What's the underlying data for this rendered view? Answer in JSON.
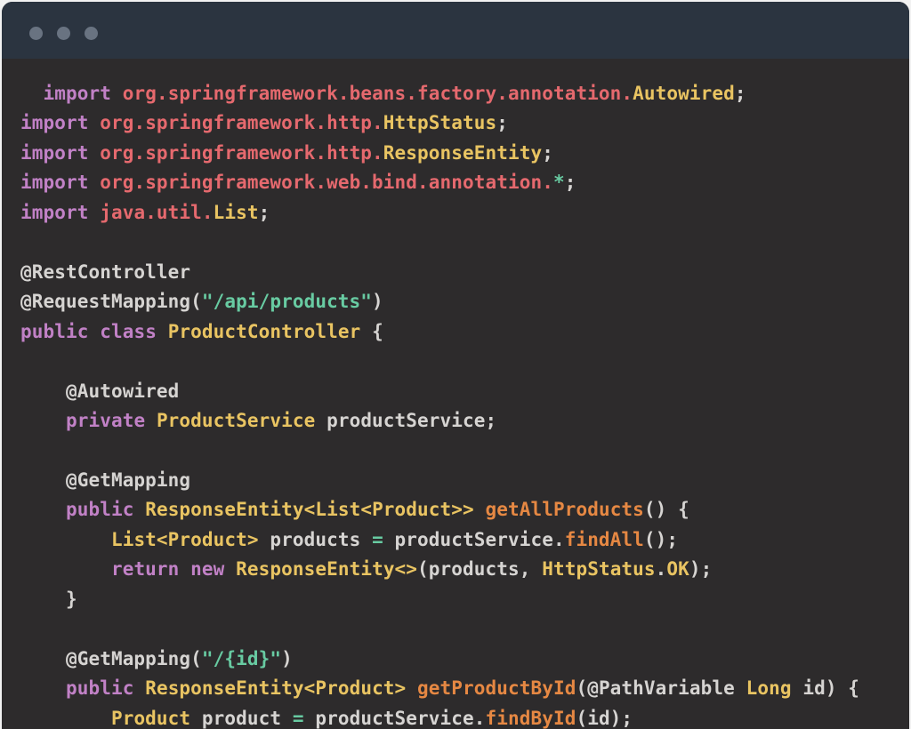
{
  "window": {
    "titlebar": {
      "controls": [
        "window-dot",
        "window-dot",
        "window-dot"
      ]
    },
    "colors": {
      "page_background": "#f2f2f2",
      "titlebar_background": "#2b3440",
      "code_background": "#2d2b2c",
      "dot": "#697381"
    }
  },
  "code": {
    "language": "java",
    "token_colors": {
      "kw": "#c181c6",
      "pkg": "#e5696e",
      "type": "#e9c462",
      "str": "#68cba2",
      "op": "#68cba2",
      "fn": "#e68843",
      "fg": "#d6d4d2"
    },
    "lines": [
      [
        {
          "c": "fg",
          "t": "  "
        },
        {
          "c": "kw",
          "t": "import"
        },
        {
          "c": "fg",
          "t": " "
        },
        {
          "c": "pkg",
          "t": "org.springframework.beans.factory.annotation."
        },
        {
          "c": "type",
          "t": "Autowired"
        },
        {
          "c": "fg",
          "t": ";"
        }
      ],
      [
        {
          "c": "kw",
          "t": "import"
        },
        {
          "c": "fg",
          "t": " "
        },
        {
          "c": "pkg",
          "t": "org.springframework.http."
        },
        {
          "c": "type",
          "t": "HttpStatus"
        },
        {
          "c": "fg",
          "t": ";"
        }
      ],
      [
        {
          "c": "kw",
          "t": "import"
        },
        {
          "c": "fg",
          "t": " "
        },
        {
          "c": "pkg",
          "t": "org.springframework.http."
        },
        {
          "c": "type",
          "t": "ResponseEntity"
        },
        {
          "c": "fg",
          "t": ";"
        }
      ],
      [
        {
          "c": "kw",
          "t": "import"
        },
        {
          "c": "fg",
          "t": " "
        },
        {
          "c": "pkg",
          "t": "org.springframework.web.bind.annotation."
        },
        {
          "c": "op",
          "t": "*"
        },
        {
          "c": "fg",
          "t": ";"
        }
      ],
      [
        {
          "c": "kw",
          "t": "import"
        },
        {
          "c": "fg",
          "t": " "
        },
        {
          "c": "pkg",
          "t": "java.util."
        },
        {
          "c": "type",
          "t": "List"
        },
        {
          "c": "fg",
          "t": ";"
        }
      ],
      [],
      [
        {
          "c": "fg",
          "t": "@RestController"
        }
      ],
      [
        {
          "c": "fg",
          "t": "@RequestMapping("
        },
        {
          "c": "str",
          "t": "\"/api/products\""
        },
        {
          "c": "fg",
          "t": ")"
        }
      ],
      [
        {
          "c": "kw",
          "t": "public"
        },
        {
          "c": "fg",
          "t": " "
        },
        {
          "c": "kw",
          "t": "class"
        },
        {
          "c": "fg",
          "t": " "
        },
        {
          "c": "type",
          "t": "ProductController"
        },
        {
          "c": "fg",
          "t": " {"
        }
      ],
      [],
      [
        {
          "c": "fg",
          "t": "    @Autowired"
        }
      ],
      [
        {
          "c": "fg",
          "t": "    "
        },
        {
          "c": "kw",
          "t": "private"
        },
        {
          "c": "fg",
          "t": " "
        },
        {
          "c": "type",
          "t": "ProductService"
        },
        {
          "c": "fg",
          "t": " productService;"
        }
      ],
      [],
      [
        {
          "c": "fg",
          "t": "    @GetMapping"
        }
      ],
      [
        {
          "c": "fg",
          "t": "    "
        },
        {
          "c": "kw",
          "t": "public"
        },
        {
          "c": "fg",
          "t": " "
        },
        {
          "c": "type",
          "t": "ResponseEntity<List<Product>>"
        },
        {
          "c": "fg",
          "t": " "
        },
        {
          "c": "fn",
          "t": "getAllProducts"
        },
        {
          "c": "fg",
          "t": "() {"
        }
      ],
      [
        {
          "c": "fg",
          "t": "        "
        },
        {
          "c": "type",
          "t": "List<Product>"
        },
        {
          "c": "fg",
          "t": " products "
        },
        {
          "c": "op",
          "t": "="
        },
        {
          "c": "fg",
          "t": " productService."
        },
        {
          "c": "fn",
          "t": "findAll"
        },
        {
          "c": "fg",
          "t": "();"
        }
      ],
      [
        {
          "c": "fg",
          "t": "        "
        },
        {
          "c": "kw",
          "t": "return"
        },
        {
          "c": "fg",
          "t": " "
        },
        {
          "c": "kw",
          "t": "new"
        },
        {
          "c": "fg",
          "t": " "
        },
        {
          "c": "type",
          "t": "ResponseEntity<>"
        },
        {
          "c": "fg",
          "t": "(products, "
        },
        {
          "c": "type",
          "t": "HttpStatus"
        },
        {
          "c": "fg",
          "t": "."
        },
        {
          "c": "type",
          "t": "OK"
        },
        {
          "c": "fg",
          "t": ");"
        }
      ],
      [
        {
          "c": "fg",
          "t": "    }"
        }
      ],
      [],
      [
        {
          "c": "fg",
          "t": "    @GetMapping("
        },
        {
          "c": "str",
          "t": "\"/{id}\""
        },
        {
          "c": "fg",
          "t": ")"
        }
      ],
      [
        {
          "c": "fg",
          "t": "    "
        },
        {
          "c": "kw",
          "t": "public"
        },
        {
          "c": "fg",
          "t": " "
        },
        {
          "c": "type",
          "t": "ResponseEntity<Product>"
        },
        {
          "c": "fg",
          "t": " "
        },
        {
          "c": "fn",
          "t": "getProductById"
        },
        {
          "c": "fg",
          "t": "(@PathVariable "
        },
        {
          "c": "type",
          "t": "Long"
        },
        {
          "c": "fg",
          "t": " id) {"
        }
      ],
      [
        {
          "c": "fg",
          "t": "        "
        },
        {
          "c": "type",
          "t": "Product"
        },
        {
          "c": "fg",
          "t": " product "
        },
        {
          "c": "op",
          "t": "="
        },
        {
          "c": "fg",
          "t": " productService."
        },
        {
          "c": "fn",
          "t": "findById"
        },
        {
          "c": "fg",
          "t": "(id);"
        }
      ]
    ]
  }
}
